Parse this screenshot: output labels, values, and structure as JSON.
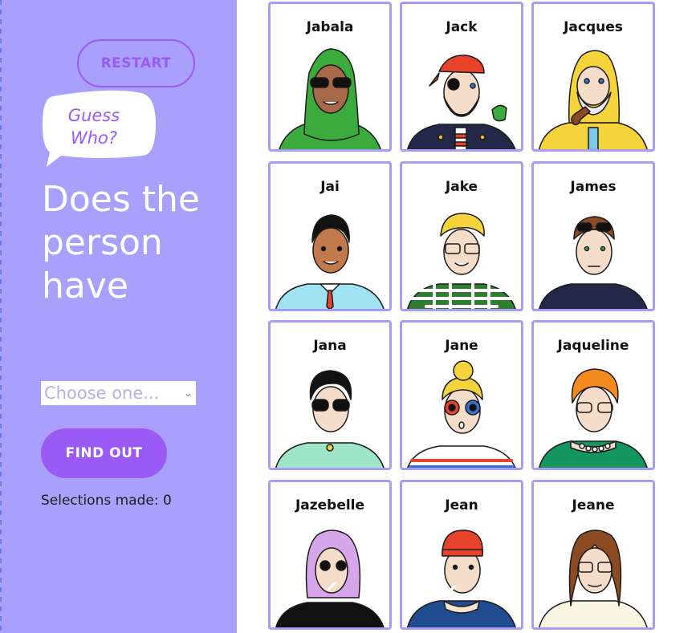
{
  "sidebar": {
    "restart_label": "RESTART",
    "logo_line1": "Guess",
    "logo_line2": "Who?",
    "question": "Does the person have",
    "select": {
      "selected": "Choose one..."
    },
    "findout_label": "FIND OUT",
    "selections_text": "Selections made: 0"
  },
  "colors": {
    "sidebar_bg": "#a9a0fd",
    "accent": "#9b59f5",
    "card_border": "#a79cf6"
  },
  "cards": [
    {
      "name": "Jabala"
    },
    {
      "name": "Jack"
    },
    {
      "name": "Jacques"
    },
    {
      "name": "Jai"
    },
    {
      "name": "Jake"
    },
    {
      "name": "James"
    },
    {
      "name": "Jana"
    },
    {
      "name": "Jane"
    },
    {
      "name": "Jaqueline"
    },
    {
      "name": "Jazebelle"
    },
    {
      "name": "Jean"
    },
    {
      "name": "Jeane"
    }
  ]
}
